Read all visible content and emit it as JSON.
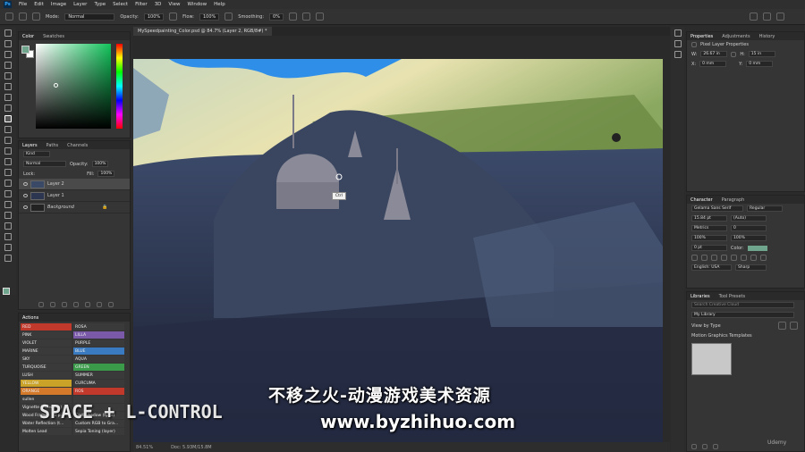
{
  "menubar": {
    "logo": "Ps",
    "items": [
      "File",
      "Edit",
      "Image",
      "Layer",
      "Type",
      "Select",
      "Filter",
      "3D",
      "View",
      "Window",
      "Help"
    ]
  },
  "options": {
    "mode_label": "Mode:",
    "mode_value": "Normal",
    "opacity_label": "Opacity:",
    "opacity_value": "100%",
    "flow_label": "Flow:",
    "flow_value": "100%",
    "smoothing_label": "Smoothing:",
    "smoothing_value": "0%"
  },
  "color_panel": {
    "tabs": [
      "Color",
      "Swatches"
    ]
  },
  "layers_panel": {
    "tabs": [
      "Layers",
      "Paths",
      "Channels"
    ],
    "kind": "Kind",
    "blend": "Normal",
    "opacity_label": "Opacity:",
    "opacity_value": "100%",
    "lock_label": "Lock:",
    "fill_label": "Fill:",
    "fill_value": "100%",
    "layers": [
      "Layer 2",
      "Layer 1",
      "Background"
    ]
  },
  "actions_panel": {
    "title": "Actions",
    "left": [
      "RED",
      "PINK",
      "VIOLET",
      "MARINE",
      "SKY",
      "TURQUOISE",
      "LUSH",
      "YELLOW",
      "ORANGE",
      "sullen",
      "Vignette (selection)",
      "Wood Frame - 50 p...",
      "Water Reflection (t...",
      "Molten Lead"
    ],
    "right": [
      "ROSA",
      "LILLA",
      "PURPLE",
      "BLUE",
      "AQUA",
      "GREEN",
      "SUMMER",
      "CURCUMA",
      "ROS",
      "",
      "",
      "Cast Shadow (type)",
      "Custom RGB to Gra...",
      "Sepia Toning (layer)"
    ],
    "left_colors": [
      "#c0392b",
      "#3a3a3a",
      "#3a3a3a",
      "#3a3a3a",
      "#3a3a3a",
      "#3a3a3a",
      "#3a3a3a",
      "#c9a227",
      "#d4782a",
      "#3a3a3a",
      "#3a3a3a",
      "#3a3a3a",
      "#3a3a3a",
      "#3a3a3a"
    ],
    "right_colors": [
      "#3a3a3a",
      "#7a5aa8",
      "#3a3a3a",
      "#3a7ac0",
      "#3a3a3a",
      "#3a9a4a",
      "#3a3a3a",
      "#3a3a3a",
      "#c0392b",
      "#3a3a3a",
      "#3a3a3a",
      "#3a3a3a",
      "#3a3a3a",
      "#3a3a3a"
    ]
  },
  "document": {
    "tab_title": "MySpeedpainting_Color.psd @ 84.7% (Layer 2, RGB/8#) *",
    "tooltip": "Ctrl",
    "zoom": "84.51%",
    "doc_info": "Doc: 5.93M/15.8M"
  },
  "properties_panel": {
    "tabs": [
      "Properties",
      "Adjustments",
      "History"
    ],
    "title": "Pixel Layer Properties",
    "w_label": "W:",
    "w_value": "26.67 in",
    "h_label": "H:",
    "h_value": "15 in",
    "x_label": "X:",
    "x_value": "0 mm",
    "y_label": "Y:",
    "y_value": "0 mm"
  },
  "character_panel": {
    "tabs": [
      "Character",
      "Paragraph"
    ],
    "font": "Gelama Sans Serif",
    "style": "Regular",
    "size": "15.84 pt",
    "leading": "(Auto)",
    "kerning": "Metrics",
    "tracking": "0",
    "vscale": "100%",
    "hscale": "100%",
    "baseline": "0 pt",
    "color_label": "Color:",
    "language": "English: USA",
    "aa": "Sharp"
  },
  "libraries_panel": {
    "tabs": [
      "Libraries",
      "Tool Presets"
    ],
    "search": "Search Creative Cloud",
    "library": "My Library",
    "view_by": "View by Type",
    "group": "Motion Graphics Templates"
  },
  "overlays": {
    "caption": "不移之火-动漫游戏美术资源",
    "url": "www.byzhihuo.com",
    "shortcut": "SPACE + L-CONTROL",
    "brand": "Udemy"
  },
  "colors": {
    "accent": "#31a8ff",
    "fg_swatch": "#6fa58c",
    "char_color": "#6fa58c"
  }
}
